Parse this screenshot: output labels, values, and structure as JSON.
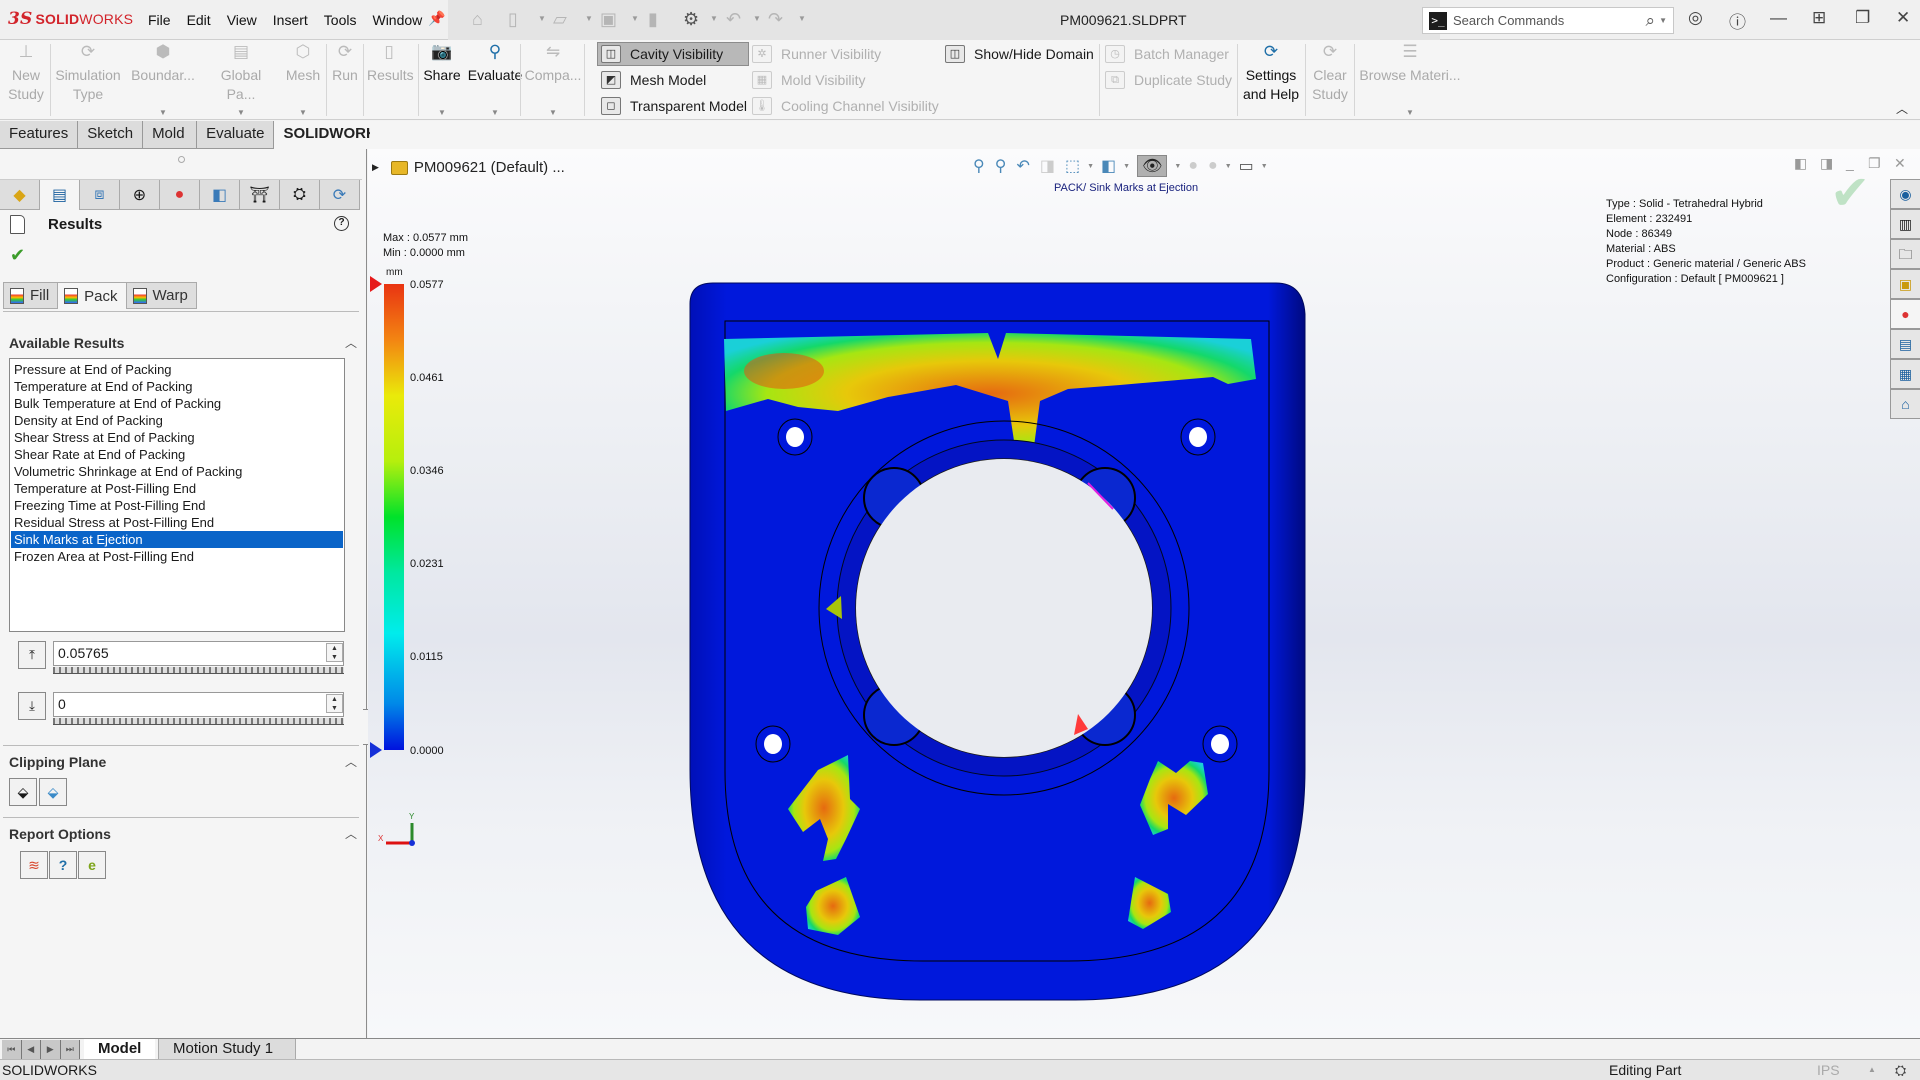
{
  "app": {
    "brand_ds": "3S",
    "brand_solid": "SOLID",
    "brand_works": "WORKS",
    "document_title": "PM009621.SLDPRT"
  },
  "menu": [
    "File",
    "Edit",
    "View",
    "Insert",
    "Tools",
    "Window"
  ],
  "search": {
    "placeholder": "Search Commands"
  },
  "ribbon": {
    "big_buttons": [
      {
        "label1": "New",
        "label2": "Study",
        "enabled": false
      },
      {
        "label1": "Simulation",
        "label2": "Type",
        "enabled": false
      },
      {
        "label1": "Boundar...",
        "label2": "",
        "enabled": false
      },
      {
        "label1": "Global Pa...",
        "label2": "",
        "enabled": false
      },
      {
        "label1": "Mesh",
        "label2": "",
        "enabled": false
      },
      {
        "label1": "Run",
        "label2": "",
        "enabled": false
      },
      {
        "label1": "Results",
        "label2": "",
        "enabled": false
      },
      {
        "label1": "Share",
        "label2": "",
        "enabled": true
      },
      {
        "label1": "Evaluate",
        "label2": "",
        "enabled": true
      },
      {
        "label1": "Compa...",
        "label2": "",
        "enabled": false
      }
    ],
    "visibility": {
      "cavity": "Cavity Visibility",
      "mesh_model": "Mesh Model",
      "transparent": "Transparent Model",
      "runner": "Runner Visibility",
      "mold": "Mold Visibility",
      "cooling": "Cooling Channel Visibility",
      "show_hide_domain": "Show/Hide Domain"
    },
    "batch_manager": "Batch Manager",
    "duplicate_study": "Duplicate Study",
    "settings_help_1": "Settings",
    "settings_help_2": "and Help",
    "clear_study_1": "Clear",
    "clear_study_2": "Study",
    "browse_materials": "Browse Materi..."
  },
  "tabs": [
    {
      "label": "Features",
      "active": false
    },
    {
      "label": "Sketch",
      "active": false
    },
    {
      "label": "Mold Tools",
      "active": false
    },
    {
      "label": "Evaluate",
      "active": false
    },
    {
      "label": "SOLIDWORKS Plastics",
      "active": true
    }
  ],
  "left_panel": {
    "title": "Results",
    "subtabs": [
      "Fill",
      "Pack",
      "Warp"
    ],
    "active_subtab": "Pack",
    "available_results_heading": "Available Results",
    "available_results": [
      "Pressure at End of Packing",
      "Temperature at End of Packing",
      "Bulk Temperature at End of Packing",
      "Density at End of Packing",
      "Shear Stress at End of Packing",
      "Shear Rate at End of Packing",
      "Volumetric Shrinkage at End of Packing",
      "Temperature at Post-Filling End",
      "Freezing Time at Post-Filling End",
      "Residual Stress at Post-Filling End",
      "Sink Marks at Ejection",
      "Frozen Area at Post-Filling End"
    ],
    "selected_result": "Sink Marks at Ejection",
    "range_max_value": "0.05765",
    "range_min_value": "0",
    "clipping_plane_heading": "Clipping Plane",
    "report_options_heading": "Report Options"
  },
  "viewport": {
    "tree_label": "PM009621 (Default) ...",
    "plot_title": "PACK/ Sink Marks at Ejection",
    "max_label": "Max : 0.0577 mm",
    "min_label": "Min : 0.0000 mm",
    "mesh_info": [
      "Type : Solid - Tetrahedral Hybrid",
      "Element : 232491",
      "Node : 86349",
      "Material : ABS",
      "Product : Generic material / Generic ABS",
      "Configuration : Default [ PM009621 ]"
    ],
    "legend": {
      "unit": "mm",
      "ticks": [
        "0.0577",
        "0.0461",
        "0.0346",
        "0.0231",
        "0.0115",
        "0.0000"
      ],
      "max": 0.0577,
      "min": 0.0
    },
    "triad": {
      "x": "X",
      "y": "Y"
    }
  },
  "bottom_tabs": [
    "Model",
    "Motion Study 1"
  ],
  "status": {
    "left": "SOLIDWORKS",
    "mode": "Editing Part",
    "units": "IPS"
  }
}
